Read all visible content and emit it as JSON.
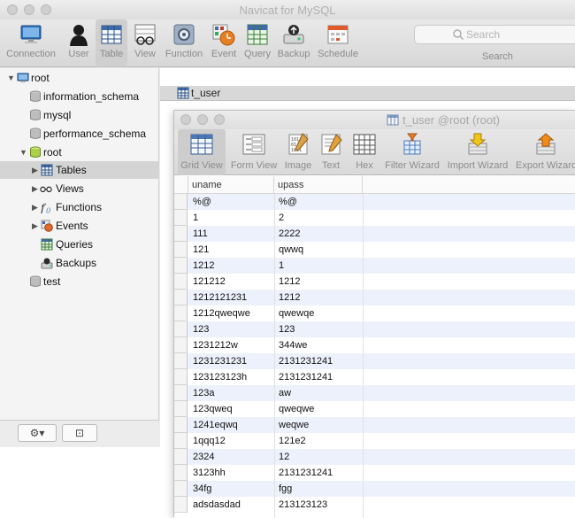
{
  "main_window": {
    "title": "Navicat for MySQL",
    "toolbar": [
      {
        "label": "Connection",
        "icon": "monitor-connection-icon"
      },
      {
        "label": "User",
        "icon": "user-silhouette-icon"
      },
      {
        "label": "Table",
        "icon": "table-grid-icon",
        "active": true
      },
      {
        "label": "View",
        "icon": "glasses-view-icon"
      },
      {
        "label": "Function",
        "icon": "function-gear-icon"
      },
      {
        "label": "Event",
        "icon": "event-clock-icon"
      },
      {
        "label": "Query",
        "icon": "query-grid-icon"
      },
      {
        "label": "Backup",
        "icon": "backup-drive-icon"
      },
      {
        "label": "Schedule",
        "icon": "calendar-schedule-icon"
      }
    ],
    "search": {
      "placeholder": "Search",
      "label": "Search"
    }
  },
  "sidebar": {
    "tree": [
      {
        "label": "root",
        "icon": "server-connection-icon",
        "expanded": true
      },
      {
        "label": "information_schema",
        "icon": "database-icon"
      },
      {
        "label": "mysql",
        "icon": "database-icon"
      },
      {
        "label": "performance_schema",
        "icon": "database-icon"
      },
      {
        "label": "root",
        "icon": "database-open-icon",
        "expanded": true
      },
      {
        "label": "Tables",
        "icon": "tables-icon",
        "selected": true
      },
      {
        "label": "Views",
        "icon": "views-glasses-icon"
      },
      {
        "label": "Functions",
        "icon": "functions-fx-icon"
      },
      {
        "label": "Events",
        "icon": "events-icon"
      },
      {
        "label": "Queries",
        "icon": "queries-icon"
      },
      {
        "label": "Backups",
        "icon": "backups-icon"
      },
      {
        "label": "test",
        "icon": "database-icon"
      }
    ],
    "footer": {
      "gear_symbol": "⚙▾",
      "panel_symbol": "⊡"
    }
  },
  "tab": {
    "label": "t_user"
  },
  "inner_window": {
    "title": "t_user @root (root)",
    "toolbar": [
      {
        "label": "Grid View",
        "icon": "grid-view-icon",
        "active": true
      },
      {
        "label": "Form View",
        "icon": "form-view-icon"
      },
      {
        "label": "Image",
        "icon": "image-binary-icon"
      },
      {
        "label": "Text",
        "icon": "text-document-icon"
      },
      {
        "label": "Hex",
        "icon": "hex-grid-icon"
      },
      {
        "label": "Filter Wizard",
        "icon": "filter-wizard-icon"
      },
      {
        "label": "Import Wizard",
        "icon": "import-wizard-icon"
      },
      {
        "label": "Export Wizard",
        "icon": "export-wizard-icon"
      }
    ],
    "grid": {
      "columns": [
        "uname",
        "upass"
      ],
      "rows": [
        [
          "%@",
          "%@"
        ],
        [
          "1",
          "2"
        ],
        [
          "111",
          "2222"
        ],
        [
          "121",
          "qwwq"
        ],
        [
          "1212",
          "1"
        ],
        [
          "121212",
          "1212"
        ],
        [
          "1212121231",
          "1212"
        ],
        [
          "1212qweqwe",
          "qwewqe"
        ],
        [
          "123",
          "123"
        ],
        [
          "1231212w",
          "344we"
        ],
        [
          "1231231231",
          "2131231241"
        ],
        [
          "123123123h",
          "2131231241"
        ],
        [
          "123a",
          "aw"
        ],
        [
          "123qweq",
          "qweqwe"
        ],
        [
          "1241eqwq",
          "weqwe"
        ],
        [
          "1qqq12",
          "121e2"
        ],
        [
          "2324",
          "12"
        ],
        [
          "3123hh",
          "2131231241"
        ],
        [
          "34fg",
          "fgg"
        ],
        [
          "adsdasdad",
          "213123123"
        ]
      ]
    }
  }
}
